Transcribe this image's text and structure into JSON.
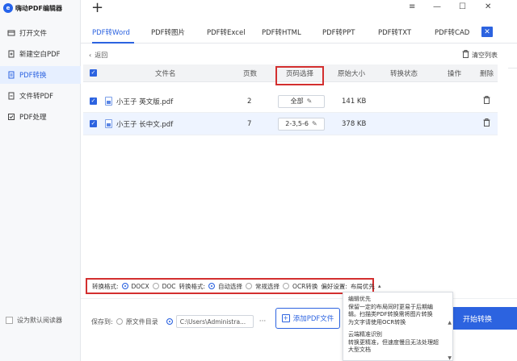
{
  "app": {
    "title": "嗨动PDF编辑器",
    "logo_letter": "e"
  },
  "window": {
    "minimize": "—",
    "restore": "☐",
    "close": "✕",
    "more": "≡",
    "new_tab": "+"
  },
  "sidebar": {
    "items": [
      {
        "label": "打开文件",
        "icon": "folder-open-icon"
      },
      {
        "label": "新建空白PDF",
        "icon": "new-file-icon"
      },
      {
        "label": "PDF转换",
        "icon": "convert-icon",
        "active": true
      },
      {
        "label": "文件转PDF",
        "icon": "file-to-pdf-icon"
      },
      {
        "label": "PDF处理",
        "icon": "pdf-process-icon"
      }
    ],
    "default_reader": "设为默认阅读器"
  },
  "tabs": [
    "PDF转Word",
    "PDF转图片",
    "PDF转Excel",
    "PDF转HTML",
    "PDF转PPT",
    "PDF转TXT",
    "PDF转CAD"
  ],
  "toolbar": {
    "back": "返回",
    "clear_list": "清空列表"
  },
  "table": {
    "headers": {
      "file_name": "文件名",
      "pages": "页数",
      "page_select": "页码选择",
      "original_size": "原始大小",
      "status": "转换状态",
      "action": "操作",
      "delete": "删除"
    },
    "rows": [
      {
        "name": "小王子 英文版.pdf",
        "pages": "2",
        "page_select": "全部",
        "size": "141 KB",
        "selected": false
      },
      {
        "name": "小王子 长中文.pdf",
        "pages": "7",
        "page_select": "2-3,5-6",
        "size": "378 KB",
        "selected": true
      }
    ]
  },
  "options": {
    "format_label": "转换格式:",
    "docx": "DOCX",
    "doc": "DOC",
    "mode_label": "转换格式:",
    "auto": "自动选择",
    "normal": "常规选择",
    "ocr": "OCR转换",
    "pref_label": "偏好设置:",
    "pref_value": "布局优先"
  },
  "bottom": {
    "save_to": "保存到:",
    "original_dir": "原文件目录",
    "path": "C:\\Users\\Administra...",
    "path_more": "···",
    "add_pdf": "添加PDF文件",
    "start": "开始转换"
  },
  "tooltip": {
    "line1": "编辑优先",
    "line2": "保留一定的布局同时更易于后期编",
    "line3": "辑。扫描类PDF转换需将图片转换",
    "line4": "为文字请使用OCR转换",
    "line5": "云端精准识别",
    "line6": "转换更精准，但速度慢且无法处理超",
    "line7": "大型文档"
  },
  "colors": {
    "accent": "#2c63e0",
    "highlight": "#d32f2f",
    "sidebar_active_bg": "#e6efff"
  }
}
